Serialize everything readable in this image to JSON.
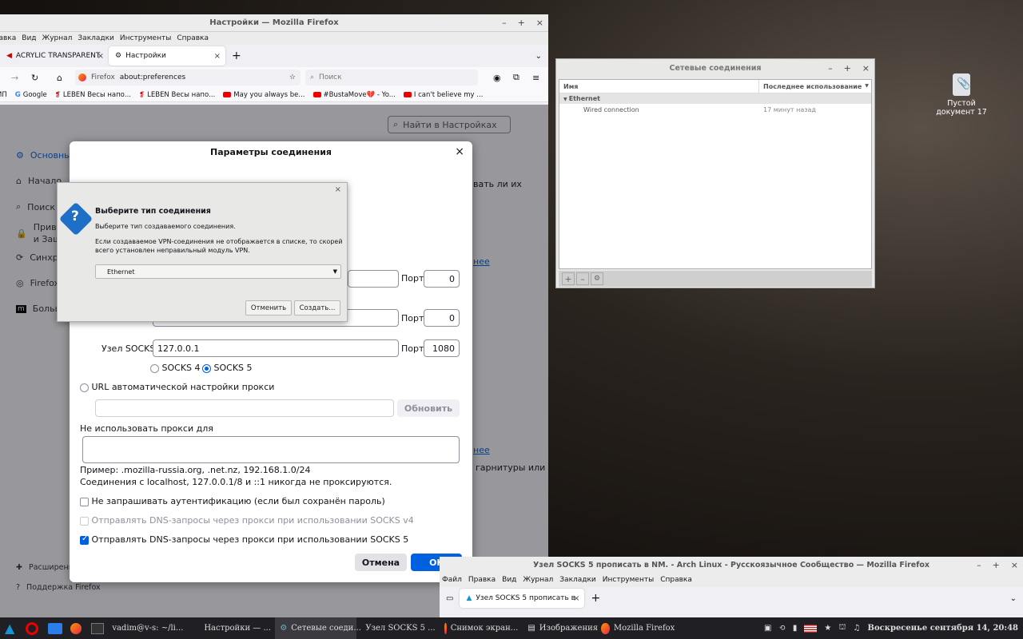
{
  "desktop": {
    "icon_label": "Пустой документ 17"
  },
  "firefox": {
    "window_title": "Настройки — Mozilla Firefox",
    "menu": [
      "Правка",
      "Вид",
      "Журнал",
      "Закладки",
      "Инструменты",
      "Справка"
    ],
    "tabs": [
      {
        "label": "ACRYLIC TRANSPARENT"
      },
      {
        "label": "Настройки"
      }
    ],
    "identity": "Firefox",
    "url": "about:preferences",
    "search_placeholder": "Поиск",
    "bookmarks": [
      "ИП",
      "Google",
      "LEBEN Весы напо...",
      "LEBEN Весы напо...",
      "May you always be...",
      "#BustaMove💔 - Yo...",
      "I can't believe my ..."
    ],
    "prefs_search": "Найти в Настройках",
    "sidebar": [
      "Основные",
      "Начало",
      "Поиск",
      "Приватность и Защита",
      "Синхронизация",
      "Firefox",
      "Больше от Mozilla"
    ],
    "sidebar_bottom": [
      "Расширения и темы",
      "Поддержка Firefox"
    ],
    "bg_text": [
      "вать ли их",
      "нее",
      "нее",
      "гарнитуры или"
    ]
  },
  "conn": {
    "title": "Параметры соединения",
    "port_label": "Порт",
    "http_port": "0",
    "https_port": "0",
    "socks_host_label": "Узел SOCKS",
    "socks_host": "127.0.0.1",
    "socks_port": "1080",
    "socks4": "SOCKS 4",
    "socks5": "SOCKS 5",
    "auto_url": "URL автоматической настройки прокси",
    "reload": "Обновить",
    "no_proxy": "Не использовать прокси для",
    "example": "Пример: .mozilla-russia.org, .net.nz, 192.168.1.0/24",
    "localhost": "Соединения с localhost, 127.0.0.1/8 и ::1 никогда не проксируются.",
    "cb_auth": "Не запрашивать аутентификацию (если был сохранён пароль)",
    "cb_dns4": "Отправлять DNS-запросы через прокси при использовании SOCKS v4",
    "cb_dns5": "Отправлять DNS-запросы через прокси при использовании SOCKS 5",
    "cancel": "Отмена",
    "ok": "OK"
  },
  "gtk": {
    "heading": "Выберите тип соединения",
    "sub": "Выберите тип создаваемого соединения.",
    "note": "Если создаваемое VPN-соединения не отображается в списке, то скорей всего установлен неправильный модуль VPN.",
    "selected": "Ethernet",
    "cancel": "Отменить",
    "create": "Создать..."
  },
  "nm": {
    "title": "Сетевые соединения",
    "col_name": "Имя",
    "col_used": "Последнее использование",
    "group": "Ethernet",
    "conn_name": "Wired connection",
    "conn_used": "17 минут назад"
  },
  "firefox2": {
    "title": "Узел SOCKS 5 прописать в NM. - Arch Linux - Русскоязычное Сообщество — Mozilla Firefox",
    "menu": [
      "Файл",
      "Правка",
      "Вид",
      "Журнал",
      "Закладки",
      "Инструменты",
      "Справка"
    ],
    "tab": "Узел SOCKS 5 прописать в"
  },
  "taskbar": {
    "items": [
      "vadim@v-s: ~/li...",
      "Настройки — ...",
      "Сетевые соеди...",
      "Узел SOCKS 5 ...",
      "Снимок экран...",
      "Изображения",
      "Mozilla Firefox"
    ],
    "clock": "Воскресенье сентября 14, 20:48"
  }
}
